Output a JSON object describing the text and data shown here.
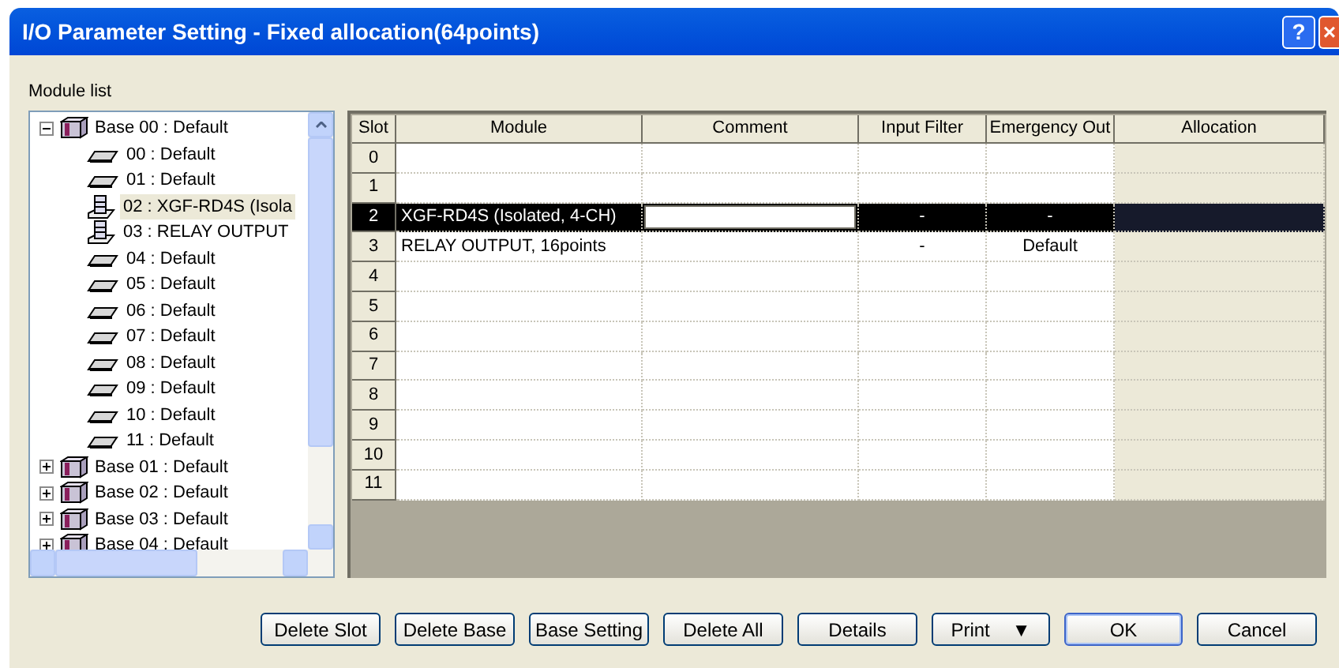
{
  "window": {
    "title": "I/O Parameter Setting - Fixed allocation(64points)",
    "help": "?",
    "close": "×"
  },
  "module_list": {
    "label": "Module list",
    "tree": [
      {
        "label": "Base 00 : Default",
        "kind": "base",
        "expanded": true,
        "children": [
          {
            "label": "00 : Default",
            "kind": "empty",
            "selected": false
          },
          {
            "label": "01 : Default",
            "kind": "empty",
            "selected": false
          },
          {
            "label": "02 :  XGF-RD4S (Isola",
            "kind": "module",
            "selected": true
          },
          {
            "label": "03 : RELAY OUTPUT",
            "kind": "module",
            "selected": false
          },
          {
            "label": "04 : Default",
            "kind": "empty",
            "selected": false
          },
          {
            "label": "05 : Default",
            "kind": "empty",
            "selected": false
          },
          {
            "label": "06 : Default",
            "kind": "empty",
            "selected": false
          },
          {
            "label": "07 : Default",
            "kind": "empty",
            "selected": false
          },
          {
            "label": "08 : Default",
            "kind": "empty",
            "selected": false
          },
          {
            "label": "09 : Default",
            "kind": "empty",
            "selected": false
          },
          {
            "label": "10 : Default",
            "kind": "empty",
            "selected": false
          },
          {
            "label": "11 : Default",
            "kind": "empty",
            "selected": false
          }
        ]
      },
      {
        "label": "Base 01 : Default",
        "kind": "base",
        "expanded": false
      },
      {
        "label": "Base 02 : Default",
        "kind": "base",
        "expanded": false
      },
      {
        "label": "Base 03 : Default",
        "kind": "base",
        "expanded": false
      },
      {
        "label": "Base 04 : Default",
        "kind": "base",
        "expanded": false
      }
    ]
  },
  "table": {
    "columns": [
      "Slot",
      "Module",
      "Comment",
      "Input Filter",
      "Emergency Out",
      "Allocation"
    ],
    "rows": [
      {
        "slot": "0",
        "selected": false
      },
      {
        "slot": "1",
        "selected": false
      },
      {
        "slot": "2",
        "module": "XGF-RD4S (Isolated, 4-CH)",
        "input_filter": "-",
        "emergency_out": "-",
        "selected": true,
        "editing": true
      },
      {
        "slot": "3",
        "module": "RELAY OUTPUT, 16points",
        "input_filter": "-",
        "emergency_out": "Default",
        "selected": false
      },
      {
        "slot": "4",
        "selected": false
      },
      {
        "slot": "5",
        "selected": false
      },
      {
        "slot": "6",
        "selected": false
      },
      {
        "slot": "7",
        "selected": false
      },
      {
        "slot": "8",
        "selected": false
      },
      {
        "slot": "9",
        "selected": false
      },
      {
        "slot": "10",
        "selected": false
      },
      {
        "slot": "11",
        "selected": false
      }
    ]
  },
  "buttons": [
    {
      "label": "Delete Slot",
      "default": false
    },
    {
      "label": "Delete Base",
      "default": false
    },
    {
      "label": "Base Setting",
      "default": false
    },
    {
      "label": "Delete All",
      "default": false
    },
    {
      "label": "Details",
      "default": false
    },
    {
      "label": "Print",
      "arrow": "▼",
      "default": false
    },
    {
      "label": "OK",
      "default": true
    },
    {
      "label": "Cancel",
      "default": false
    }
  ]
}
